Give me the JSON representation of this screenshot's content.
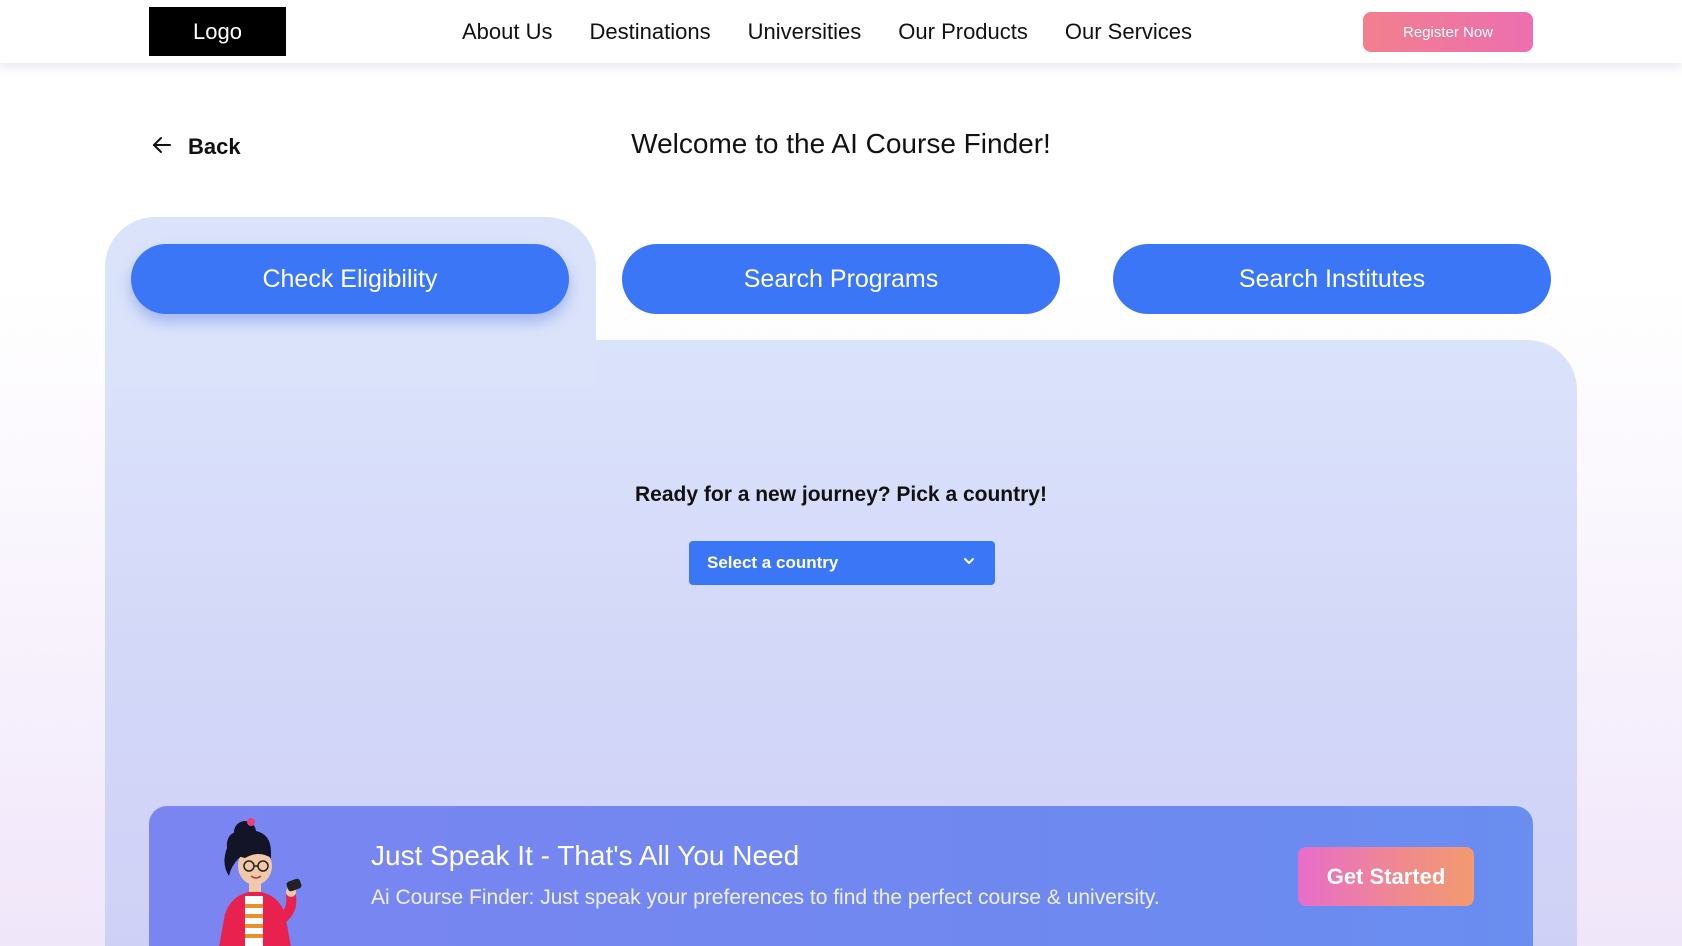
{
  "header": {
    "logo": "Logo",
    "nav": [
      "About Us",
      "Destinations",
      "Universities",
      "Our Products",
      "Our Services"
    ],
    "register_label": "Register Now"
  },
  "back_label": "Back",
  "page_title": "Welcome to the AI Course Finder!",
  "tabs": [
    {
      "label": "Check Eligibility",
      "active": true
    },
    {
      "label": "Search Programs",
      "active": false
    },
    {
      "label": "Search Institutes",
      "active": false
    }
  ],
  "prompt": "Ready for a new journey? Pick a country!",
  "country_select": {
    "value": "Select a country"
  },
  "banner": {
    "title": "Just Speak It - That's All You Need",
    "subtitle": "Ai Course Finder: Just speak your preferences to find the perfect course & university.",
    "cta_label": "Get Started"
  },
  "colors": {
    "primary": "#3b76f6",
    "panel": "#dbe3fb",
    "register_gradient": [
      "#f27f8e",
      "#ec6fb0"
    ],
    "cta_gradient": [
      "#e86dc9",
      "#f29a70"
    ]
  },
  "icons": {
    "back": "arrow-left-icon",
    "dropdown": "chevron-down-icon",
    "illustration": "woman-with-microphone-illustration"
  }
}
